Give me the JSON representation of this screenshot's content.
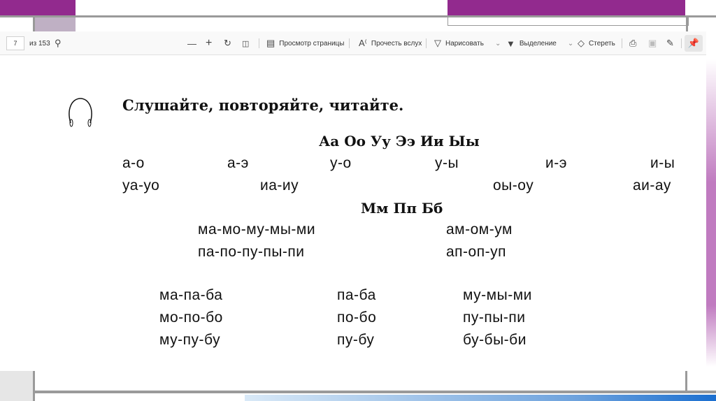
{
  "toolbar": {
    "page_number": "7",
    "page_total": "из 153",
    "page_view": "Просмотр страницы",
    "read_aloud": "Прочесть вслух",
    "draw": "Нарисовать",
    "highlight": "Выделение",
    "erase": "Стереть"
  },
  "content": {
    "title": "Слушайте, повторяйте, читайте.",
    "heading1": "Аа Оо Уу Ээ Ии Ыы",
    "row1": [
      "а-о",
      "а-э",
      "у-о",
      "у-ы",
      "и-э",
      "и-ы"
    ],
    "row2": [
      "уа-уо",
      "иа-иу",
      "оы-оу",
      "аи-ау"
    ],
    "heading2": "Мм Пп Бб",
    "block1": [
      [
        "ма-мо-му-мы-ми",
        "ам-ом-ум"
      ],
      [
        "па-по-пу-пы-пи",
        "ап-оп-уп"
      ]
    ],
    "block2": [
      [
        "ма-па-ба",
        "па-ба",
        "му-мы-ми"
      ],
      [
        "мо-по-бо",
        "по-бо",
        "пу-пы-пи"
      ],
      [
        "му-пу-бу",
        "пу-бу",
        "бу-бы-би"
      ]
    ]
  },
  "colors": {
    "accent": "#922a8e"
  }
}
